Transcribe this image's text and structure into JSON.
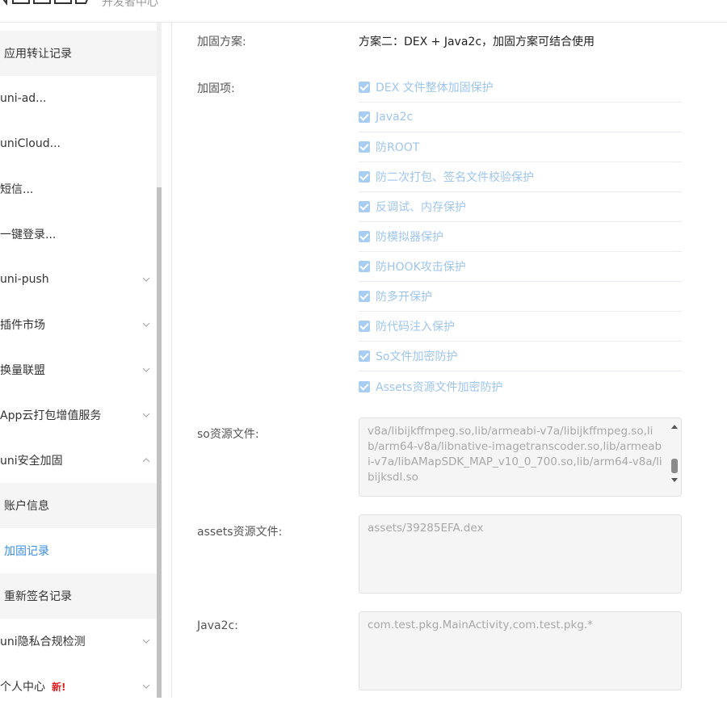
{
  "header": {
    "subtitle": "开发者中心"
  },
  "sidebar": {
    "items": [
      {
        "label": "应用转让记录",
        "type": "sub"
      },
      {
        "label": "uni-ad...",
        "type": "plain"
      },
      {
        "label": "uniCloud...",
        "type": "plain"
      },
      {
        "label": "短信...",
        "type": "plain"
      },
      {
        "label": "一键登录...",
        "type": "plain"
      },
      {
        "label": "uni-push",
        "type": "expandable"
      },
      {
        "label": "插件市场",
        "type": "expandable"
      },
      {
        "label": "换量联盟",
        "type": "expandable"
      },
      {
        "label": "App云打包增值服务",
        "type": "expandable"
      },
      {
        "label": "uni安全加固",
        "type": "expanded"
      },
      {
        "label": "账户信息",
        "type": "sub"
      },
      {
        "label": "加固记录",
        "type": "sub-active"
      },
      {
        "label": "重新签名记录",
        "type": "sub"
      },
      {
        "label": "uni隐私合规检测",
        "type": "expandable"
      },
      {
        "label": "个人中心",
        "type": "expandable",
        "badge": "新!"
      }
    ]
  },
  "main": {
    "scheme_label": "加固方案:",
    "scheme_value": "方案二：DEX + Java2c，加固方案可结合使用",
    "items_label": "加固项:",
    "items": [
      "DEX 文件整体加固保护",
      "Java2c",
      "防ROOT",
      "防二次打包、签名文件校验保护",
      "反调试、内存保护",
      "防模拟器保护",
      "防HOOK攻击保护",
      "防多开保护",
      "防代码注入保护",
      "So文件加密防护",
      "Assets资源文件加密防护"
    ],
    "so_label": "so资源文件:",
    "so_value": "v8a/libijkffmpeg.so,lib/armeabi-v7a/libijkffmpeg.so,lib/arm64-v8a/libnative-imagetranscoder.so,lib/armeabi-v7a/libAMapSDK_MAP_v10_0_700.so,lib/arm64-v8a/libijksdl.so",
    "assets_label": "assets资源文件:",
    "assets_value": "assets/39285EFA.dex",
    "java2c_label": "Java2c:",
    "java2c_value": "com.test.pkg.MainActivity,com.test.pkg.*"
  },
  "colors": {
    "accent": "#3a8ee6",
    "checkbox_disabled": "#a8cdf2",
    "badge": "#e02020"
  },
  "icons": {
    "expand": "chevron-down-icon",
    "collapse": "chevron-up-icon",
    "check": "check-icon"
  }
}
